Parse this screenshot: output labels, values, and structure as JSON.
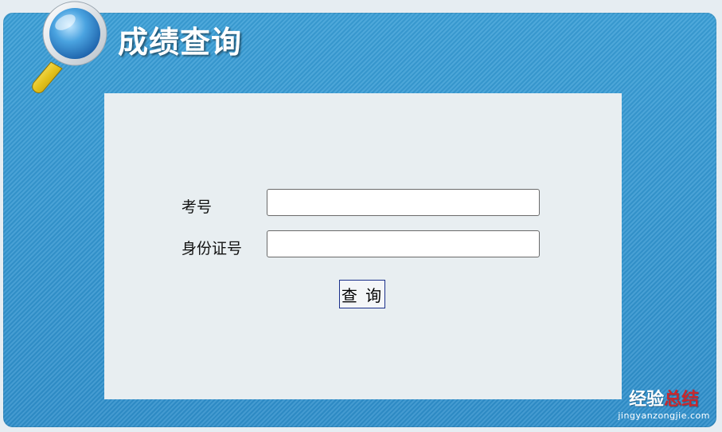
{
  "header": {
    "title": "成绩查询"
  },
  "form": {
    "exam_number_label": "考号",
    "exam_number_value": "",
    "id_number_label": "身份证号",
    "id_number_value": "",
    "submit_label": "查 询"
  },
  "watermark": {
    "cn_white": "经验",
    "cn_red": "总结",
    "url": "jingyanzongjie.com"
  },
  "icons": {
    "logo": "magnifier-icon"
  },
  "colors": {
    "frame": "#3a9ed6",
    "panel": "#e8eef1",
    "button_border": "#1a2f8a",
    "watermark_red": "#c8282e"
  }
}
